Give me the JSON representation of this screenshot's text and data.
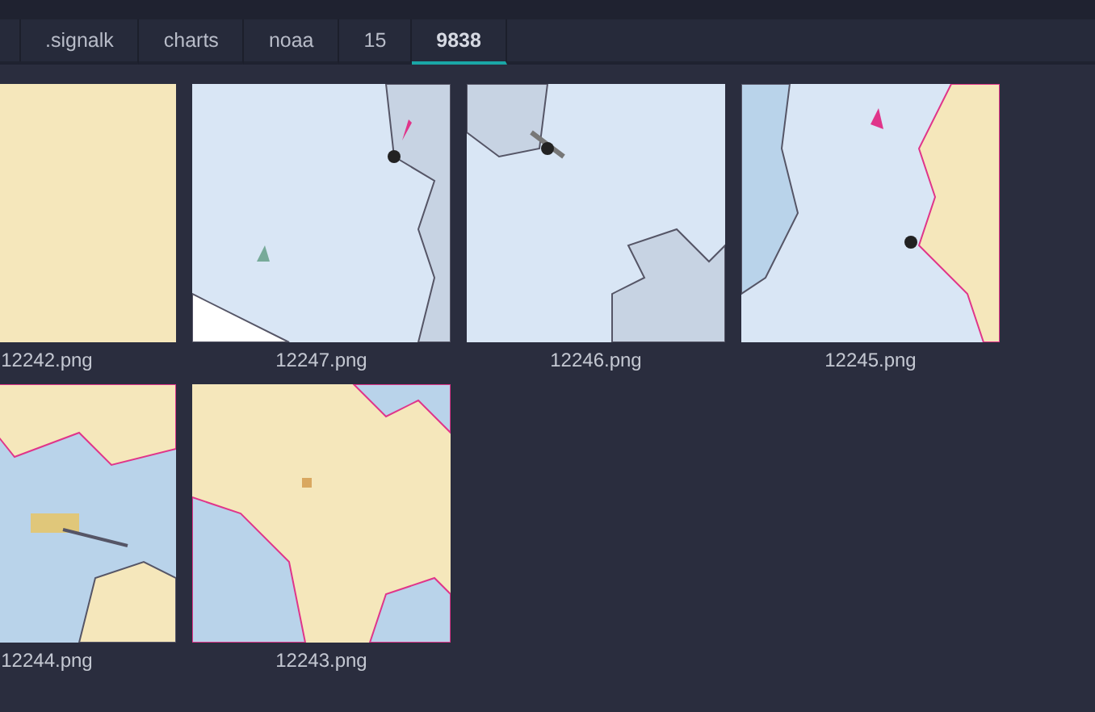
{
  "breadcrumbs": [
    {
      "label": ".signalk",
      "selected": false
    },
    {
      "label": "charts",
      "selected": false
    },
    {
      "label": "noaa",
      "selected": false
    },
    {
      "label": "15",
      "selected": false
    },
    {
      "label": "9838",
      "selected": true
    }
  ],
  "files": [
    {
      "name": "12242.png"
    },
    {
      "name": "12247.png"
    },
    {
      "name": "12246.png"
    },
    {
      "name": "12245.png"
    },
    {
      "name": "12244.png"
    },
    {
      "name": "12243.png"
    }
  ]
}
